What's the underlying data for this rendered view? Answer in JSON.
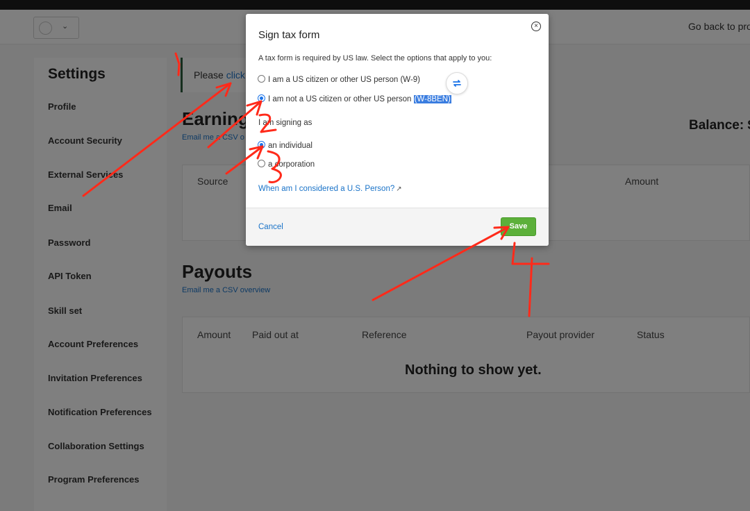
{
  "header": {
    "go_back": "Go back to pro"
  },
  "sidebar": {
    "title": "Settings",
    "items": [
      {
        "label": "Profile"
      },
      {
        "label": "Account Security"
      },
      {
        "label": "External Services"
      },
      {
        "label": "Email"
      },
      {
        "label": "Password"
      },
      {
        "label": "API Token"
      },
      {
        "label": "Skill set"
      },
      {
        "label": "Account Preferences"
      },
      {
        "label": "Invitation Preferences"
      },
      {
        "label": "Notification Preferences"
      },
      {
        "label": "Collaboration Settings"
      },
      {
        "label": "Program Preferences"
      }
    ]
  },
  "notice": {
    "text": "Please ",
    "link": "click h"
  },
  "earnings": {
    "title": "Earning",
    "csv_link": "Email me a CSV o",
    "balance": "Balance: $",
    "columns": [
      "Source",
      "Amount"
    ]
  },
  "payouts": {
    "title": "Payouts",
    "csv_link": "Email me a CSV overview",
    "columns": [
      "Amount",
      "Paid out at",
      "Reference",
      "Payout provider",
      "Status"
    ],
    "empty_message": "Nothing to show yet."
  },
  "modal": {
    "title": "Sign tax form",
    "description": "A tax form is required by US law. Select the options that apply to you:",
    "options_person": [
      {
        "label": "I am a US citizen or other US person (W-9)",
        "checked": false
      },
      {
        "label": "I am not a US citizen or other US person ",
        "suffix": "(W-8BEN)",
        "checked": true
      }
    ],
    "signing_as_label": "I am signing as",
    "options_signing": [
      {
        "label": "an individual",
        "checked": true
      },
      {
        "label": "a corporation",
        "checked": false
      }
    ],
    "help_link": "When am I considered a U.S. Person?",
    "cancel_label": "Cancel",
    "save_label": "Save"
  },
  "annotations": {
    "color": "#ff2a1a"
  }
}
